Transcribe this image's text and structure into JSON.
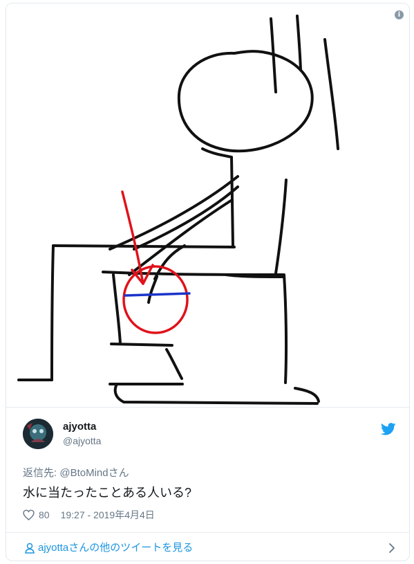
{
  "media": {
    "description_icon": "info-icon",
    "colors": {
      "ink": "#111111",
      "circle": "#e0121b",
      "arrow": "#e0121b",
      "waterline": "#1a34c9"
    }
  },
  "author": {
    "name": "ajyotta",
    "handle": "@ajyotta",
    "avatar_icon": "avatar"
  },
  "brand_icon": "twitter-bird-icon",
  "reply": {
    "prefix": "返信先:",
    "mention": "@BtoMindさん"
  },
  "tweet": {
    "text": "水に当たったことある人いる?"
  },
  "meta": {
    "like_icon": "heart-icon",
    "likes": "80",
    "timestamp": "19:27 - 2019年4月4日"
  },
  "footer": {
    "link_label": "ajyottaさんの他のツイートを見る",
    "icon": "person-icon",
    "chevron": "chevron-right-icon"
  },
  "accent_color": "#1b95e0"
}
